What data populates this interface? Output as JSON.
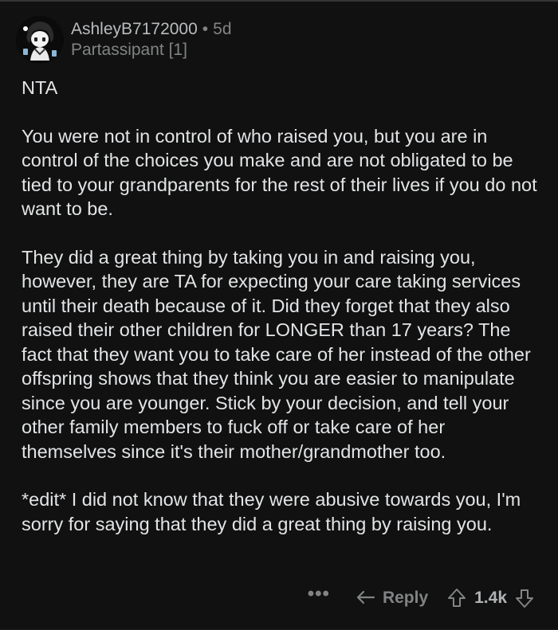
{
  "comment": {
    "username": "AshleyB7172000",
    "separator": "•",
    "age": "5d",
    "flair": "Partassipant [1]",
    "paragraphs": [
      "NTA",
      "You were not in control of who raised you, but you are in control of the choices you make and are not obligated to be tied to your grandparents for the rest of their lives if you do not want to be.",
      "They did a great thing by taking you in and raising you, however, they are TA for expecting your care taking services until their death because of it. Did they forget that they also raised their other children for LONGER than 17 years? The fact that they want you to take care of her instead of the other offspring shows that they think you are easier to manipulate since you are younger. Stick by your decision, and tell your other family members to fuck off or take care of her themselves since it's their mother/grandmother too.",
      "*edit* I did not know that they were abusive towards you, I'm sorry for saying that they did a great thing by raising you."
    ]
  },
  "actions": {
    "more_label": "•••",
    "reply_label": "Reply",
    "score": "1.4k"
  },
  "icons": {
    "avatar": "anime-avatar-icon",
    "reply": "reply-arrow-icon",
    "upvote": "upvote-arrow-icon",
    "downvote": "downvote-arrow-icon"
  },
  "colors": {
    "background": "#111111",
    "text": "#e2e4e6",
    "muted": "#818384"
  }
}
